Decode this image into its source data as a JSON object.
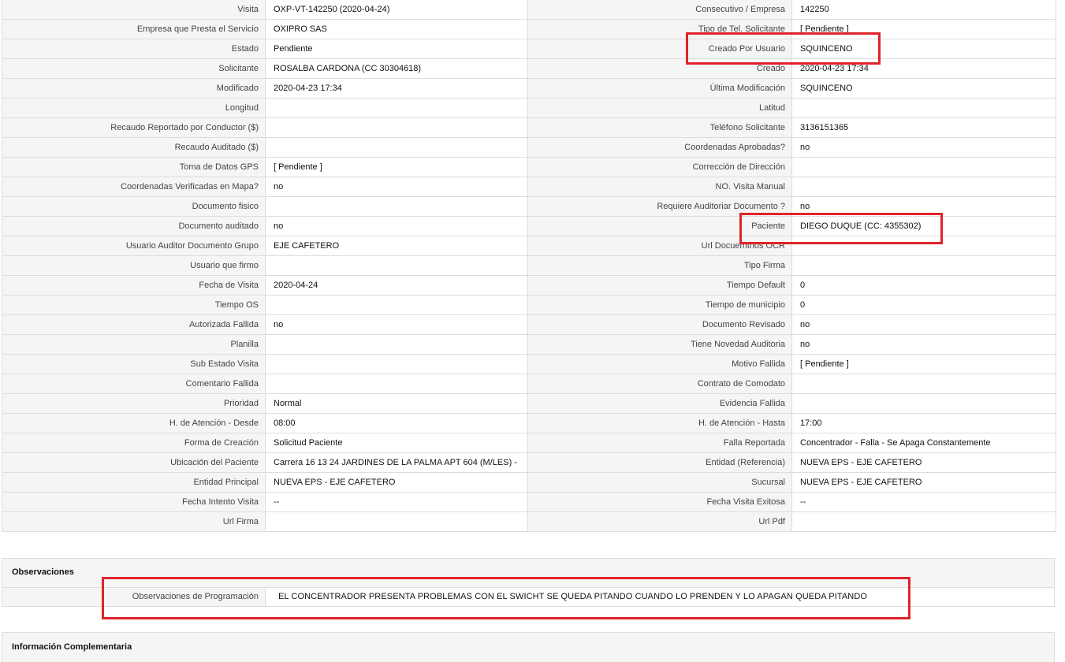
{
  "rows": [
    {
      "l1": "Visita",
      "v1": "OXP-VT-142250 (2020-04-24)",
      "l2": "Consecutivo / Empresa",
      "v2": "142250"
    },
    {
      "l1": "Empresa que Presta el Servicio",
      "v1": "OXIPRO SAS",
      "l2": "Tipo de Tel. Solicitante",
      "v2": "[ Pendiente ]"
    },
    {
      "l1": "Estado",
      "v1": "Pendiente",
      "l2": "Creado Por Usuario",
      "v2": "SQUINCENO"
    },
    {
      "l1": "Solicitante",
      "v1": "ROSALBA CARDONA (CC 30304618)",
      "l2": "Creado",
      "v2": "2020-04-23 17:34"
    },
    {
      "l1": "Modificado",
      "v1": "2020-04-23 17:34",
      "l2": "Última Modificación",
      "v2": "SQUINCENO"
    },
    {
      "l1": "Longitud",
      "v1": "",
      "l2": "Latitud",
      "v2": ""
    },
    {
      "l1": "Recaudo Reportado por Conductor ($)",
      "v1": "",
      "l2": "Teléfono Solicitante",
      "v2": "3136151365"
    },
    {
      "l1": "Recaudo Auditado ($)",
      "v1": "",
      "l2": "Coordenadas Aprobadas?",
      "v2": "no"
    },
    {
      "l1": "Toma de Datos GPS",
      "v1": "[ Pendiente ]",
      "l2": "Corrección de Dirección",
      "v2": ""
    },
    {
      "l1": "Coordenadas Verificadas en Mapa?",
      "v1": "no",
      "l2": "NO. Visita Manual",
      "v2": ""
    },
    {
      "l1": "Documento fisico",
      "v1": "",
      "l2": "Requiere Auditoriar Documento ?",
      "v2": "no"
    },
    {
      "l1": "Documento auditado",
      "v1": "no",
      "l2": "Paciente",
      "v2": "DIEGO DUQUE (CC: 4355302)"
    },
    {
      "l1": "Usuario Auditor Documento Grupo",
      "v1": "EJE CAFETERO",
      "l2": "Url Docuemtnos OCR",
      "v2": ""
    },
    {
      "l1": "Usuario que firmo",
      "v1": "",
      "l2": "Tipo Firma",
      "v2": ""
    },
    {
      "l1": "Fecha de Visita",
      "v1": "2020-04-24",
      "l2": "Tiempo Default",
      "v2": "0"
    },
    {
      "l1": "Tiempo OS",
      "v1": "",
      "l2": "Tiempo de municipio",
      "v2": "0"
    },
    {
      "l1": "Autorizada Fallida",
      "v1": "no",
      "l2": "Documento Revisado",
      "v2": "no"
    },
    {
      "l1": "Planilla",
      "v1": "",
      "l2": "Tiene Novedad Auditoria",
      "v2": "no"
    },
    {
      "l1": "Sub Estado Visita",
      "v1": "",
      "l2": "Motivo Fallida",
      "v2": "[ Pendiente ]"
    },
    {
      "l1": "Comentario Fallida",
      "v1": "",
      "l2": "Contrato de Comodato",
      "v2": ""
    },
    {
      "l1": "Prioridad",
      "v1": "Normal",
      "l2": "Evidencia Fallida",
      "v2": ""
    },
    {
      "l1": "H. de Atención - Desde",
      "v1": "08:00",
      "l2": "H. de Atención - Hasta",
      "v2": "17:00"
    },
    {
      "l1": "Forma de Creación",
      "v1": "Solicitud Paciente",
      "l2": "Falla Reportada",
      "v2": "Concentrador - Falla - Se Apaga Constantemente"
    },
    {
      "l1": "Ubicación del Paciente",
      "v1": "Carrera 16 13 24 JARDINES DE LA PALMA APT 604 (M/LES) -",
      "l2": "Entidad (Referencia)",
      "v2": "NUEVA EPS - EJE CAFETERO"
    },
    {
      "l1": "Entidad Principal",
      "v1": "NUEVA EPS - EJE CAFETERO",
      "l2": "Sucursal",
      "v2": "NUEVA EPS - EJE CAFETERO"
    },
    {
      "l1": "Fecha Intento Visita",
      "v1": "--",
      "l2": "Fecha Visita Exitosa",
      "v2": "--"
    },
    {
      "l1": "Url Firma",
      "v1": "",
      "l2": "Url Pdf",
      "v2": ""
    }
  ],
  "observaciones": {
    "title": "Observaciones",
    "label": "Observaciones de Programación",
    "value": "EL CONCENTRADOR PRESENTA PROBLEMAS CON EL SWICHT SE QUEDA PITANDO CUANDO LO PRENDEN Y LO APAGAN QUEDA PITANDO"
  },
  "complementaria": {
    "title": "Información Complementaria"
  },
  "colors": {
    "highlight": "#e0232b",
    "label_bg": "#f5f5f5",
    "border": "#dddddd"
  }
}
